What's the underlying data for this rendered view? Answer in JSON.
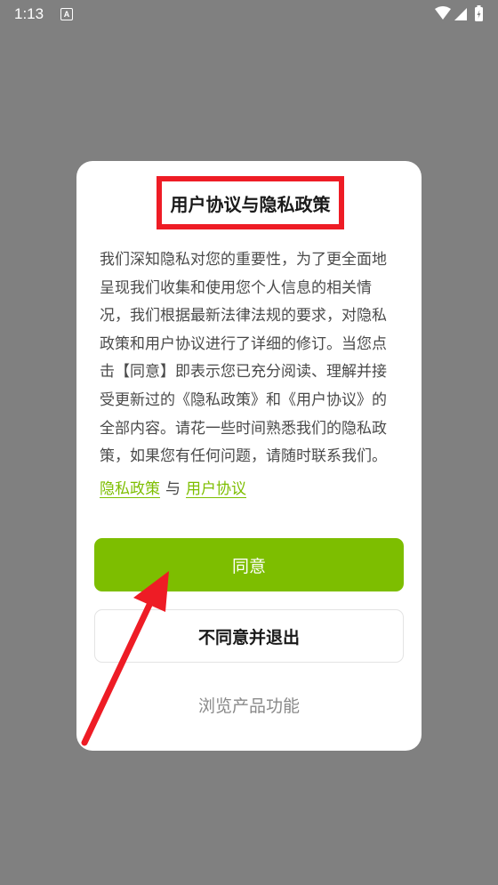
{
  "status_bar": {
    "time": "1:13",
    "notification_icon": "a-letter-icon",
    "icons": [
      "wifi-icon",
      "signal-icon",
      "battery-charging-icon"
    ]
  },
  "dialog": {
    "title": "用户协议与隐私政策",
    "body": "我们深知隐私对您的重要性，为了更全面地呈现我们收集和使用您个人信息的相关情况，我们根据最新法律法规的要求，对隐私政策和用户协议进行了详细的修订。当您点击【同意】即表示您已充分阅读、理解并接受更新过的《隐私政策》和《用户协议》的全部内容。请花一些时间熟悉我们的隐私政策，如果您有任何问题，请随时联系我们。",
    "privacy_link": "隐私政策",
    "separator": "与",
    "user_agreement_link": "用户协议",
    "agree_button": "同意",
    "disagree_button": "不同意并退出",
    "browse_link": "浏览产品功能"
  },
  "colors": {
    "accent": "#7dbe00",
    "annotation_red": "#ee1c25",
    "overlay": "#808080"
  }
}
